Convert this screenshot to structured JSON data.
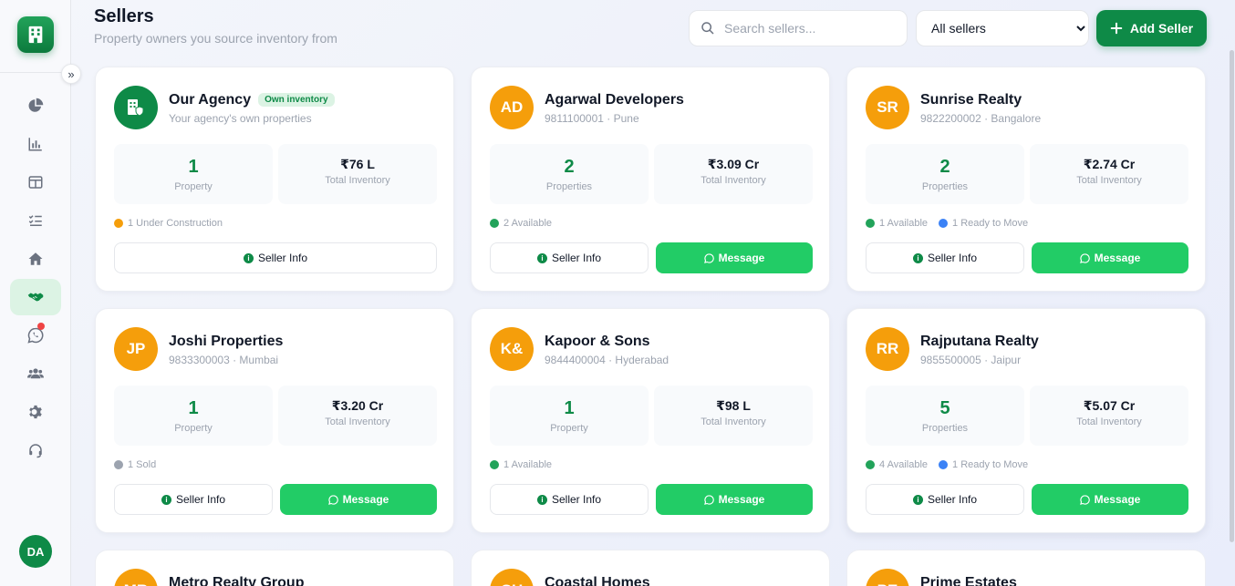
{
  "header": {
    "title": "Sellers",
    "subtitle": "Property owners you source inventory from"
  },
  "search": {
    "placeholder": "Search sellers..."
  },
  "filter": {
    "selected": "All sellers"
  },
  "add_button": {
    "label": "Add Seller"
  },
  "sidebar": {
    "nav": [
      "pie-chart-icon",
      "bar-chart-icon",
      "layout-icon",
      "checklist-icon",
      "home-icon",
      "handshake-icon",
      "whatsapp-icon",
      "users-icon",
      "gear-icon",
      "headset-icon"
    ],
    "active": "handshake-icon",
    "user_initials": "DA"
  },
  "colors": {
    "primary": "#0e8a47",
    "accent_orange": "#f59e0b",
    "whatsapp": "#22cc66"
  },
  "sellers": [
    {
      "initials": "",
      "name": "Our Agency",
      "badge": "Own inventory",
      "meta": "Your agency's own properties",
      "count": "1",
      "count_label": "Property",
      "inventory": "₹76 L",
      "inventory_label": "Total Inventory",
      "statuses": [
        {
          "color": "orange",
          "text": "1 Under Construction"
        }
      ],
      "info_label": "Seller Info",
      "message_label": ""
    },
    {
      "initials": "AD",
      "name": "Agarwal Developers",
      "meta": "9811100001 · Pune",
      "count": "2",
      "count_label": "Properties",
      "inventory": "₹3.09 Cr",
      "inventory_label": "Total Inventory",
      "statuses": [
        {
          "color": "green",
          "text": "2 Available"
        }
      ],
      "info_label": "Seller Info",
      "message_label": "Message"
    },
    {
      "initials": "SR",
      "name": "Sunrise Realty",
      "meta": "9822200002 · Bangalore",
      "count": "2",
      "count_label": "Properties",
      "inventory": "₹2.74 Cr",
      "inventory_label": "Total Inventory",
      "statuses": [
        {
          "color": "green",
          "text": "1 Available"
        },
        {
          "color": "blue",
          "text": "1 Ready to Move"
        }
      ],
      "info_label": "Seller Info",
      "message_label": "Message"
    },
    {
      "initials": "JP",
      "name": "Joshi Properties",
      "meta": "9833300003 · Mumbai",
      "count": "1",
      "count_label": "Property",
      "inventory": "₹3.20 Cr",
      "inventory_label": "Total Inventory",
      "statuses": [
        {
          "color": "gray",
          "text": "1 Sold"
        }
      ],
      "info_label": "Seller Info",
      "message_label": "Message"
    },
    {
      "initials": "K&",
      "name": "Kapoor & Sons",
      "meta": "9844400004 · Hyderabad",
      "count": "1",
      "count_label": "Property",
      "inventory": "₹98 L",
      "inventory_label": "Total Inventory",
      "statuses": [
        {
          "color": "green",
          "text": "1 Available"
        }
      ],
      "info_label": "Seller Info",
      "message_label": "Message"
    },
    {
      "initials": "RR",
      "name": "Rajputana Realty",
      "meta": "9855500005 · Jaipur",
      "count": "5",
      "count_label": "Properties",
      "inventory": "₹5.07 Cr",
      "inventory_label": "Total Inventory",
      "statuses": [
        {
          "color": "green",
          "text": "4 Available"
        },
        {
          "color": "blue",
          "text": "1 Ready to Move"
        }
      ],
      "info_label": "Seller Info",
      "message_label": "Message"
    }
  ],
  "peek_sellers": [
    {
      "initials": "MR",
      "name": "Metro Realty Group"
    },
    {
      "initials": "CH",
      "name": "Coastal Homes"
    },
    {
      "initials": "PE",
      "name": "Prime Estates"
    }
  ]
}
